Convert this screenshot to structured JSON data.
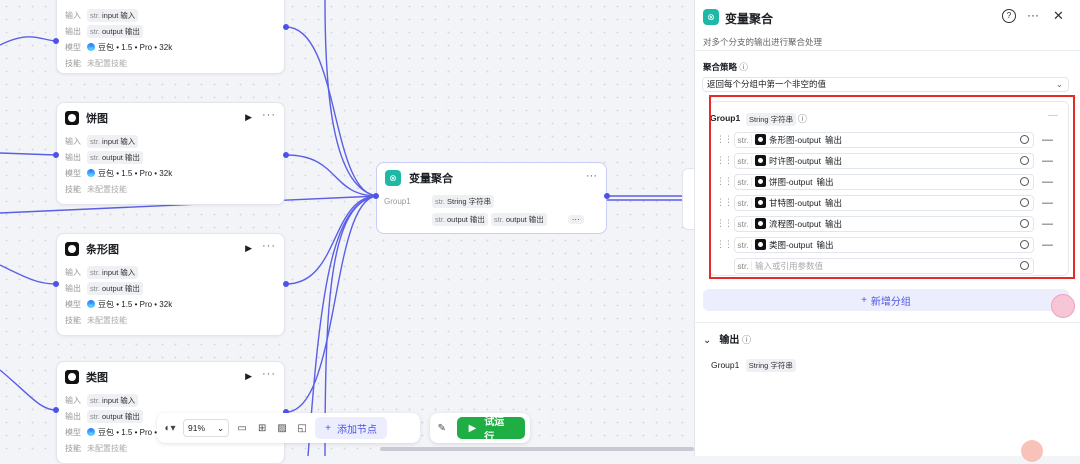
{
  "nodes": [
    {
      "title": "",
      "in_key": "输入",
      "in_val": "input",
      "in_type": "输入",
      "out_key": "输出",
      "out_val": "output",
      "out_type": "输出",
      "model_key": "模型",
      "model": "豆包 • 1.5 • Pro • 32k",
      "skill_key": "技能",
      "skill": "未配置技能"
    },
    {
      "title": "饼图",
      "in_key": "输入",
      "in_val": "input",
      "in_type": "输入",
      "out_key": "输出",
      "out_val": "output",
      "out_type": "输出",
      "model_key": "模型",
      "model": "豆包 • 1.5 • Pro • 32k",
      "skill_key": "技能",
      "skill": "未配置技能"
    },
    {
      "title": "条形图",
      "in_key": "输入",
      "in_val": "input",
      "in_type": "输入",
      "out_key": "输出",
      "out_val": "output",
      "out_type": "输出",
      "model_key": "模型",
      "model": "豆包 • 1.5 • Pro • 32k",
      "skill_key": "技能",
      "skill": "未配置技能"
    },
    {
      "title": "类图",
      "in_key": "输入",
      "in_val": "input",
      "in_type": "输入",
      "out_key": "输出",
      "out_val": "output",
      "out_type": "输出",
      "model_key": "模型",
      "model": "豆包 • 1.5 • Pro • 32k",
      "skill_key": "技能",
      "skill": "未配置技能"
    }
  ],
  "str_badge": "str.",
  "agg_node": {
    "title": "变量聚合",
    "group": "Group1",
    "type_val": "String",
    "type_label": "字符串",
    "out1": "output",
    "out1_label": "输出",
    "out2": "output",
    "out2_label": "输出"
  },
  "toolbar": {
    "zoom": "91%",
    "add_node": "添加节点",
    "run": "试运行"
  },
  "panel": {
    "title": "变量聚合",
    "desc": "对多个分支的输出进行聚合处理",
    "strategy_label": "聚合策略",
    "strategy_value": "返回每个分组中第一个非空的值",
    "group_name": "Group1",
    "group_type": "String",
    "group_type_label": "字符串",
    "params": [
      {
        "node": "条形图",
        "sep": " - ",
        "var": "output",
        "label": "输出"
      },
      {
        "node": "时许图",
        "sep": " - ",
        "var": "output",
        "label": "输出"
      },
      {
        "node": "饼图",
        "sep": " - ",
        "var": "output",
        "label": "输出"
      },
      {
        "node": "甘特图",
        "sep": " - ",
        "var": "output",
        "label": "输出"
      },
      {
        "node": "流程图",
        "sep": " - ",
        "var": "output",
        "label": "输出"
      },
      {
        "node": "类图",
        "sep": " - ",
        "var": "output",
        "label": "输出"
      }
    ],
    "param_placeholder": "输入或引用参数值",
    "add_group": "新增分组",
    "output_section": "输出",
    "output_group": "Group1",
    "output_type": "String",
    "output_type_label": "字符串"
  },
  "colors": {
    "accent": "#4d53e8",
    "teal": "#1fb8a6",
    "run": "#1fae44",
    "highlight": "#e52a2a"
  }
}
